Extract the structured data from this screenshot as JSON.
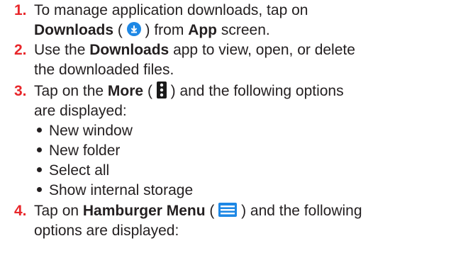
{
  "step1": {
    "num": "1.",
    "line1": "To manage application downloads, tap on",
    "bold1": "Downloads",
    "paren_open": " ( ",
    "paren_close": " ) from ",
    "bold2": "App",
    "tail": " screen."
  },
  "step2": {
    "num": "2.",
    "pre": "Use the ",
    "bold": "Downloads",
    "post": " app to view, open, or delete",
    "line2": "the downloaded files."
  },
  "step3": {
    "num": "3.",
    "pre": "Tap on the ",
    "bold": "More",
    "paren_open": " ( ",
    "post": " ) and the following options",
    "line2": "are displayed:",
    "options": [
      "New window",
      "New folder",
      "Select all",
      "Show internal storage"
    ]
  },
  "step4": {
    "num": "4.",
    "pre": "Tap on ",
    "bold": "Hamburger Menu",
    "paren_open": " ( ",
    "post": " ) and the following",
    "line2": "options are displayed:"
  },
  "icons": {
    "downloads": "downloads-icon",
    "more": "more-vert-icon",
    "menu": "hamburger-menu-icon"
  },
  "colors": {
    "step_number": "#e8262a",
    "icon_blue": "#1e88e5",
    "text": "#231f20"
  }
}
